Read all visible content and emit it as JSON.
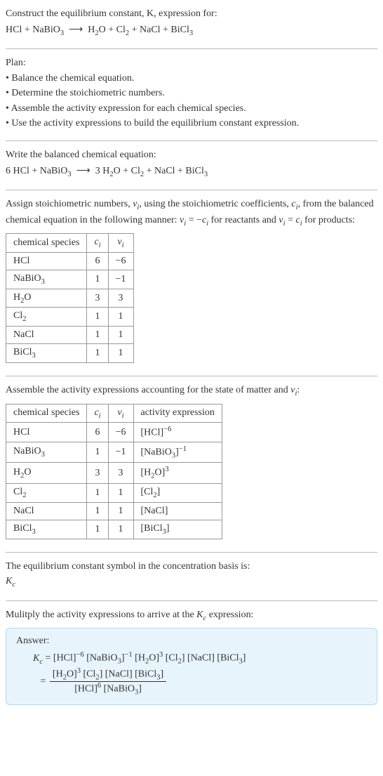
{
  "intro": {
    "title_line": "Construct the equilibrium constant, K, expression for:",
    "equation_html": "HCl + NaBiO<span class=\"sub\">3</span>&nbsp; <span class=\"arrow\">⟶</span> &nbsp;H<span class=\"sub\">2</span>O + Cl<span class=\"sub\">2</span> + NaCl + BiCl<span class=\"sub\">3</span>"
  },
  "plan": {
    "heading": "Plan:",
    "bullets": [
      "• Balance the chemical equation.",
      "• Determine the stoichiometric numbers.",
      "• Assemble the activity expression for each chemical species.",
      "• Use the activity expressions to build the equilibrium constant expression."
    ]
  },
  "balanced": {
    "heading": "Write the balanced chemical equation:",
    "equation_html": "6 HCl + NaBiO<span class=\"sub\">3</span>&nbsp; <span class=\"arrow\">⟶</span> &nbsp;3 H<span class=\"sub\">2</span>O + Cl<span class=\"sub\">2</span> + NaCl + BiCl<span class=\"sub\">3</span>"
  },
  "assign": {
    "text_html": "Assign stoichiometric numbers, <span class=\"italic\">ν<span class=\"sub\">i</span></span>, using the stoichiometric coefficients, <span class=\"italic\">c<span class=\"sub\">i</span></span>, from the balanced chemical equation in the following manner: <span class=\"italic\">ν<span class=\"sub\">i</span></span> = −<span class=\"italic\">c<span class=\"sub\">i</span></span> for reactants and <span class=\"italic\">ν<span class=\"sub\">i</span></span> = <span class=\"italic\">c<span class=\"sub\">i</span></span> for products:"
  },
  "table1": {
    "headers": [
      "chemical species",
      "c_i",
      "ν_i"
    ],
    "headers_html": [
      "chemical species",
      "<span class=\"italic\">c<span class=\"sub\">i</span></span>",
      "<span class=\"italic\">ν<span class=\"sub\">i</span></span>"
    ],
    "rows": [
      {
        "species_html": "HCl",
        "c": "6",
        "v": "−6"
      },
      {
        "species_html": "NaBiO<span class=\"sub\">3</span>",
        "c": "1",
        "v": "−1"
      },
      {
        "species_html": "H<span class=\"sub\">2</span>O",
        "c": "3",
        "v": "3"
      },
      {
        "species_html": "Cl<span class=\"sub\">2</span>",
        "c": "1",
        "v": "1"
      },
      {
        "species_html": "NaCl",
        "c": "1",
        "v": "1"
      },
      {
        "species_html": "BiCl<span class=\"sub\">3</span>",
        "c": "1",
        "v": "1"
      }
    ]
  },
  "assemble": {
    "text_html": "Assemble the activity expressions accounting for the state of matter and <span class=\"italic\">ν<span class=\"sub\">i</span></span>:"
  },
  "table2": {
    "headers_html": [
      "chemical species",
      "<span class=\"italic\">c<span class=\"sub\">i</span></span>",
      "<span class=\"italic\">ν<span class=\"sub\">i</span></span>",
      "activity expression"
    ],
    "rows": [
      {
        "species_html": "HCl",
        "c": "6",
        "v": "−6",
        "act_html": "[HCl]<span class=\"sup\">−6</span>"
      },
      {
        "species_html": "NaBiO<span class=\"sub\">3</span>",
        "c": "1",
        "v": "−1",
        "act_html": "[NaBiO<span class=\"sub\">3</span>]<span class=\"sup\">−1</span>"
      },
      {
        "species_html": "H<span class=\"sub\">2</span>O",
        "c": "3",
        "v": "3",
        "act_html": "[H<span class=\"sub\">2</span>O]<span class=\"sup\">3</span>"
      },
      {
        "species_html": "Cl<span class=\"sub\">2</span>",
        "c": "1",
        "v": "1",
        "act_html": "[Cl<span class=\"sub\">2</span>]"
      },
      {
        "species_html": "NaCl",
        "c": "1",
        "v": "1",
        "act_html": "[NaCl]"
      },
      {
        "species_html": "BiCl<span class=\"sub\">3</span>",
        "c": "1",
        "v": "1",
        "act_html": "[BiCl<span class=\"sub\">3</span>]"
      }
    ]
  },
  "symbol": {
    "line1": "The equilibrium constant symbol in the concentration basis is:",
    "line2_html": "<span class=\"italic\">K<span class=\"sub\">c</span></span>"
  },
  "multiply": {
    "text_html": "Mulitply the activity expressions to arrive at the <span class=\"italic\">K<span class=\"sub\">c</span></span> expression:"
  },
  "answer": {
    "label": "Answer:",
    "line1_html": "<span class=\"italic\">K<span class=\"sub\">c</span></span> = [HCl]<span class=\"sup\">−6</span> [NaBiO<span class=\"sub\">3</span>]<span class=\"sup\">−1</span> [H<span class=\"sub\">2</span>O]<span class=\"sup\">3</span> [Cl<span class=\"sub\">2</span>] [NaCl] [BiCl<span class=\"sub\">3</span>]",
    "frac_num_html": "[H<span class=\"sub\">2</span>O]<span class=\"sup\">3</span> [Cl<span class=\"sub\">2</span>] [NaCl] [BiCl<span class=\"sub\">3</span>]",
    "frac_den_html": "[HCl]<span class=\"sup\">6</span> [NaBiO<span class=\"sub\">3</span>]"
  },
  "chart_data": {
    "type": "table",
    "tables": [
      {
        "title": "stoichiometric numbers",
        "columns": [
          "chemical species",
          "c_i",
          "nu_i"
        ],
        "rows": [
          [
            "HCl",
            6,
            -6
          ],
          [
            "NaBiO3",
            1,
            -1
          ],
          [
            "H2O",
            3,
            3
          ],
          [
            "Cl2",
            1,
            1
          ],
          [
            "NaCl",
            1,
            1
          ],
          [
            "BiCl3",
            1,
            1
          ]
        ]
      },
      {
        "title": "activity expressions",
        "columns": [
          "chemical species",
          "c_i",
          "nu_i",
          "activity expression"
        ],
        "rows": [
          [
            "HCl",
            6,
            -6,
            "[HCl]^-6"
          ],
          [
            "NaBiO3",
            1,
            -1,
            "[NaBiO3]^-1"
          ],
          [
            "H2O",
            3,
            3,
            "[H2O]^3"
          ],
          [
            "Cl2",
            1,
            1,
            "[Cl2]"
          ],
          [
            "NaCl",
            1,
            1,
            "[NaCl]"
          ],
          [
            "BiCl3",
            1,
            1,
            "[BiCl3]"
          ]
        ]
      }
    ]
  }
}
